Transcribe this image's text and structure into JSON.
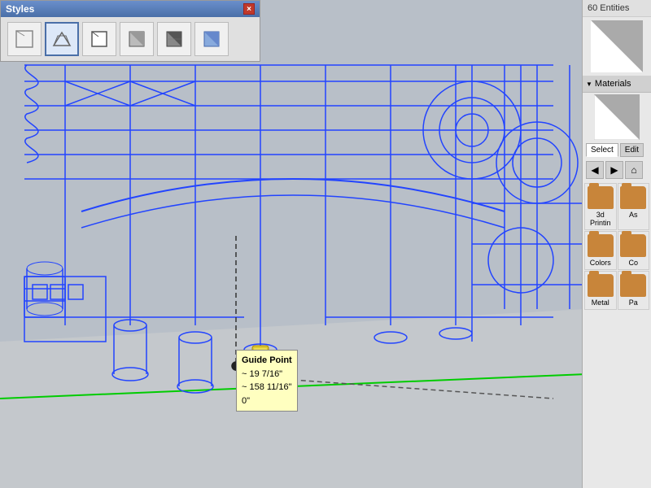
{
  "styles_panel": {
    "title": "Styles",
    "close_label": "×",
    "icons": [
      {
        "name": "wireframe-2d",
        "active": false
      },
      {
        "name": "wireframe-3d",
        "active": true
      },
      {
        "name": "hidden-line",
        "active": false
      },
      {
        "name": "shaded",
        "active": false
      },
      {
        "name": "shaded-textured",
        "active": false
      },
      {
        "name": "monochrome",
        "active": false
      }
    ]
  },
  "viewport": {
    "background_color": "#b8c0c8"
  },
  "guide_tooltip": {
    "title": "Guide Point",
    "x": "~ 19 7/16\"",
    "y": "~ 158 11/16\"",
    "z": "0\""
  },
  "right_panel": {
    "entities_count": "60 Entities",
    "materials_header": "Materials",
    "tabs": [
      {
        "label": "Select",
        "active": true
      },
      {
        "label": "Edit",
        "active": false
      }
    ],
    "nav_back": "◀",
    "nav_forward": "▶",
    "nav_home": "⌂",
    "folders": [
      {
        "label": "3d Printin",
        "icon": "folder"
      },
      {
        "label": "As",
        "icon": "folder"
      },
      {
        "label": "Colors",
        "icon": "folder"
      },
      {
        "label": "Co",
        "icon": "folder"
      },
      {
        "label": "Metal",
        "icon": "folder"
      },
      {
        "label": "Pa",
        "icon": "folder"
      }
    ]
  }
}
